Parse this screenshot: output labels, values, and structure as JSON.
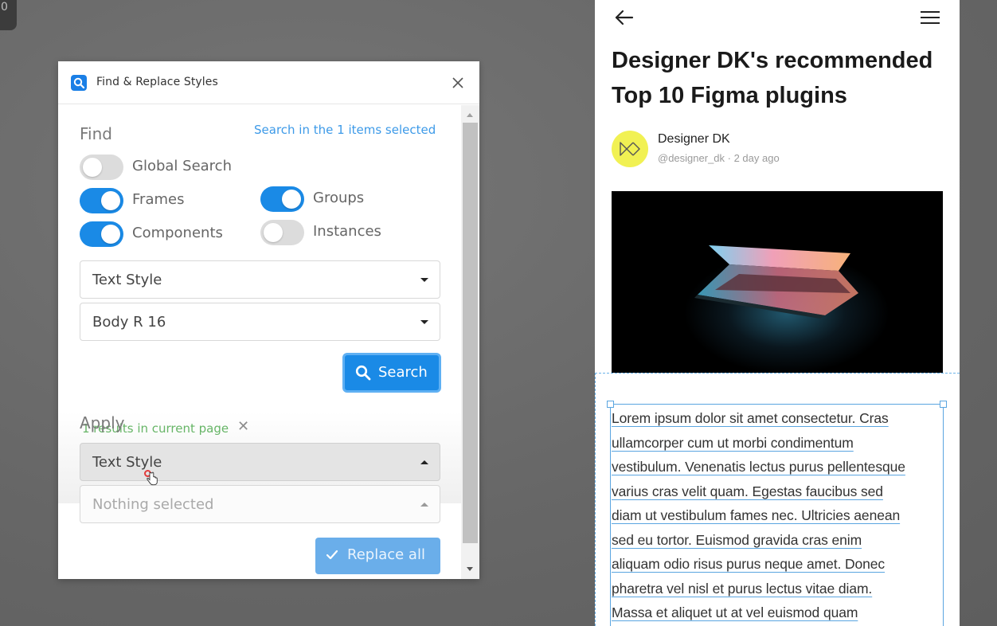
{
  "corner": {
    "label": "0"
  },
  "plugin": {
    "title": "Find & Replace Styles",
    "find": {
      "heading": "Find",
      "hint": "Search in the 1 items selected",
      "toggles": [
        {
          "label": "Global Search",
          "on": false
        },
        {
          "label": "Frames",
          "on": true
        },
        {
          "label": "Groups",
          "on": true
        },
        {
          "label": "Components",
          "on": true
        },
        {
          "label": "Instances",
          "on": false
        }
      ],
      "style_type": "Text Style",
      "style_name": "Body R 16",
      "results": "1 results in current page",
      "search_label": "Search"
    },
    "apply": {
      "heading": "Apply",
      "style_type": "Text Style",
      "style_name_placeholder": "Nothing selected",
      "replace_label": "Replace all"
    }
  },
  "article": {
    "headline_line1": "Designer DK's recommended",
    "headline_line2": "Top 10 Figma plugins",
    "author": {
      "name": "Designer DK",
      "meta": "@designer_dk · 2 day ago"
    },
    "body_lines": [
      "Lorem ipsum dolor sit amet consectetur. Cras",
      "ullamcorper cum ut morbi condimentum",
      "vestibulum. Venenatis lectus purus pellentesque",
      "varius cras velit quam. Egestas faucibus sed",
      "diam ut vestibulum fames nec. Ultricies aenean",
      "sed eu tortor. Euismod gravida cras enim",
      "aliquam odio risus purus neque amet. Donec",
      "pharetra vel nisl et purus lectus vitae diam.",
      "Massa et aliquet ut at vel euismod quam"
    ]
  },
  "colors": {
    "accent": "#1a8ae6",
    "hint": "#3d9ae8",
    "results": "#5fb35f",
    "avatar": "#f1f153",
    "selection": "#5aa5e0"
  },
  "icons": [
    "search-icon",
    "close-icon",
    "check-icon",
    "back-arrow-icon",
    "hamburger-menu-icon",
    "hand-pointer-icon"
  ]
}
